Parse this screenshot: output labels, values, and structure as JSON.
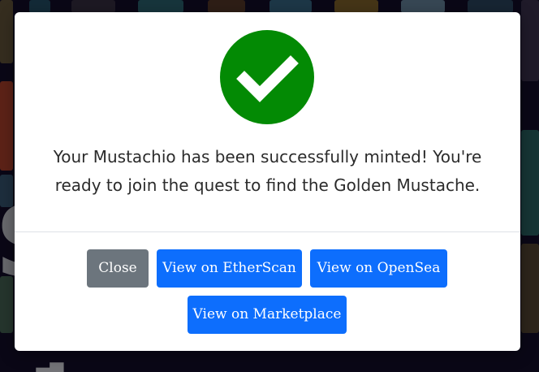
{
  "modal": {
    "icon": "checkmark-circle-icon",
    "message": "Your Mustachio has been successfully minted! You're ready to join the quest to find the Golden Mustache.",
    "buttons": {
      "close": "Close",
      "etherscan": "View on EtherScan",
      "opensea": "View on OpenSea",
      "marketplace": "View on Marketplace"
    }
  },
  "colors": {
    "success": "#038a04",
    "primary": "#0d6efd",
    "secondary": "#6c757d",
    "backdrop": "#14102a"
  }
}
